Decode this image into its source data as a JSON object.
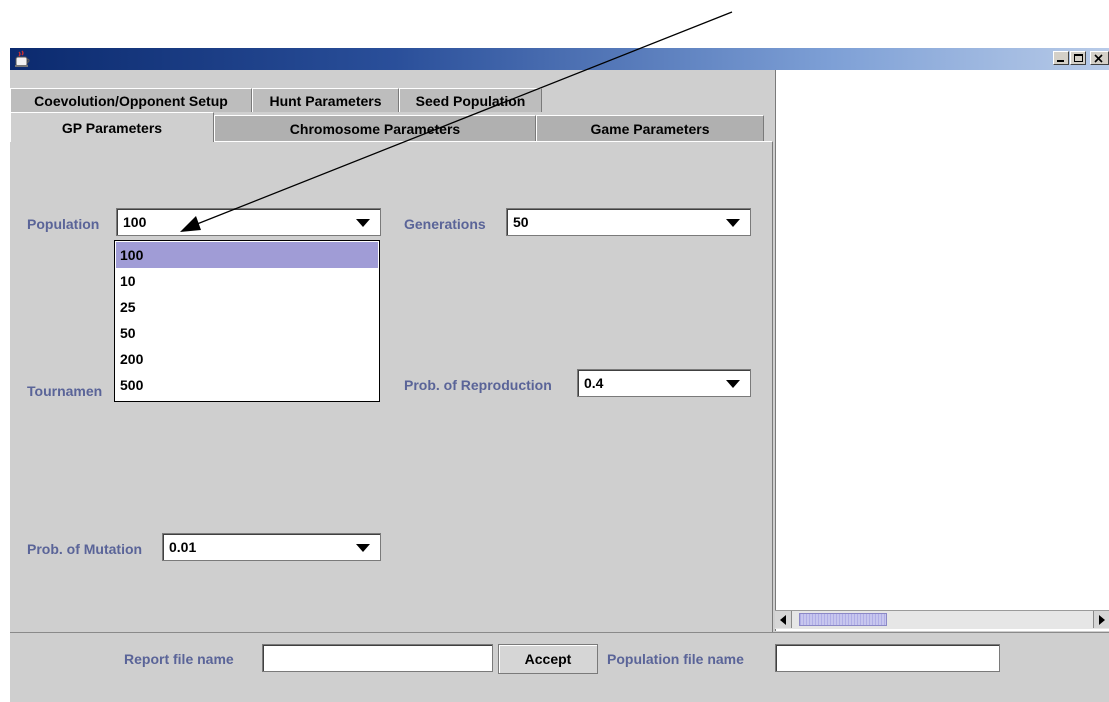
{
  "tabs": {
    "row1": [
      "Coevolution/Opponent Setup",
      "Hunt Parameters",
      "Seed Population"
    ],
    "row2": [
      "GP Parameters",
      "Chromosome Parameters",
      "Game Parameters"
    ],
    "active": "GP Parameters"
  },
  "gp_params": {
    "population": {
      "label": "Population",
      "value": "100",
      "options": [
        "100",
        "10",
        "25",
        "50",
        "200",
        "500"
      ],
      "highlighted": "100",
      "open": true
    },
    "generations": {
      "label": "Generations",
      "value": "50"
    },
    "tournament": {
      "label": "Tournamen"
    },
    "reproduction": {
      "label": "Prob. of Reproduction",
      "value": "0.4"
    },
    "mutation": {
      "label": "Prob. of Mutation",
      "value": "0.01"
    }
  },
  "bottom": {
    "report_label": "Report file name",
    "report_value": "",
    "accept_label": "Accept",
    "population_file_label": "Population file name",
    "population_file_value": ""
  },
  "titlebar": {
    "controls": [
      "minimize-icon",
      "maximize-icon",
      "close-icon"
    ]
  },
  "colors": {
    "label_text": "#5a6498",
    "selection": "#a09cd6",
    "title_dark": "#0b2a6e"
  }
}
